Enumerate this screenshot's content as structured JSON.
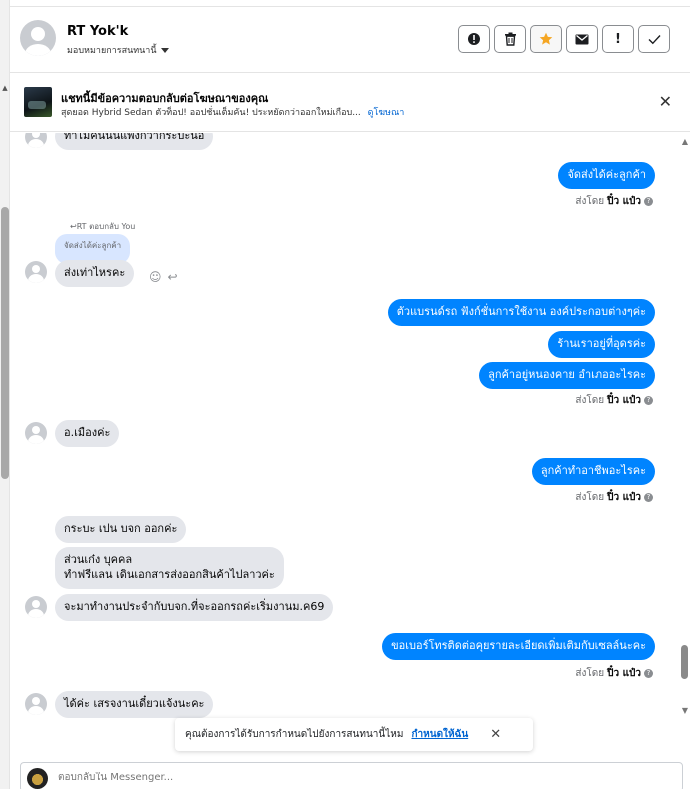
{
  "header": {
    "name": "RT Yok'k",
    "assign": "มอบหมายการสนทนานี้",
    "actions": [
      {
        "name": "alert-icon",
        "glyph": "❶"
      },
      {
        "name": "trash-icon",
        "glyph": "🗑"
      },
      {
        "name": "star-icon",
        "glyph": "★"
      },
      {
        "name": "mail-icon",
        "glyph": "✉"
      },
      {
        "name": "important-icon",
        "glyph": "!"
      },
      {
        "name": "check-icon",
        "glyph": "✓"
      }
    ]
  },
  "ad": {
    "title": "แชทนี้มีข้อความตอบกลับต่อโฆษณาของคุณ",
    "text": "สุดยอด Hybrid Sedan ตัวท็อป! ออปชั่นเต็มคัน! ประหยัดกว่าออกใหม่เกือบ...",
    "link": "ดูโฆษณา"
  },
  "messages": {
    "m0": "ทำไมคันนนแพงกวากระบะนอ",
    "m1": "จัดส่งได้ค่ะลูกค้า",
    "reply_label": "RT ตอบกลับ You",
    "quote": "จัดส่งได้ค่ะลูกค้า",
    "m2": "ส่งเท่าไหรคะ",
    "m3": "ตัวแบรนด์รถ  ฟังก์ชั่นการใช้งาน องค์ประกอบต่างๆค่ะ",
    "m4": "ร้านเราอยู่ที่อุดรค่ะ",
    "m5": "ลูกค้าอยู่หนองคาย อำเภออะไรคะ",
    "m6": "อ.เมืองค่ะ",
    "m7": "ลูกค้าทำอาชีพอะไรคะ",
    "m8": "กระบะ เปน บจก ออกค่ะ",
    "m9a": "ส่วนเก๋ง บุคคล",
    "m9b": "ทำฟรีแลน เดินเอกสารส่งออกสินค้าไปลาวค่ะ",
    "m10": "จะมาทำงานประจำกับบจก.ที่จะออกรถค่ะเริ่มงานม.ค69",
    "m11": "ขอเบอร์โทรติดต่อคุยรายละเอียดเพิ่มเติมกับเซลล์นะคะ",
    "m12": "ได้ค่ะ เสรจงานเดี๋ยวแจ้งนะคะ"
  },
  "sent_by": {
    "prefix": "ส่งโดย",
    "name": "ปิ๋ว แป๋ว"
  },
  "notice": {
    "text": "คุณต้องการได้รับการกำหนดไปยังการสนทนานี้ไหม",
    "link": "กำหนดให้ฉัน"
  },
  "composer": {
    "placeholder": "ตอบกลับใน Messenger..."
  }
}
